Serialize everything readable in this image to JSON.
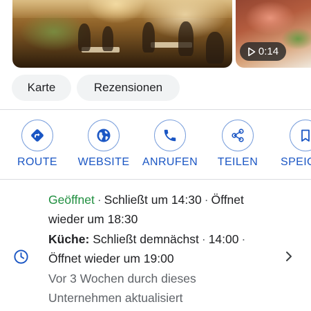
{
  "media": {
    "video_duration": "0:14",
    "play_icon": "play-icon"
  },
  "chips": {
    "map": "Karte",
    "reviews": "Rezensionen"
  },
  "actions": [
    {
      "label": "ROUTE",
      "icon": "directions-icon"
    },
    {
      "label": "WEBSITE",
      "icon": "globe-icon"
    },
    {
      "label": "ANRUFEN",
      "icon": "phone-icon"
    },
    {
      "label": "TEILEN",
      "icon": "share-icon"
    },
    {
      "label": "SPEIC",
      "icon": "bookmark-icon"
    }
  ],
  "hours": {
    "status": "Geöffnet",
    "separator": "·",
    "closes": "Schließt um 14:30",
    "reopens_part1": "Öffnet",
    "reopens_part2": "wieder um 18:30",
    "kitchen_label": "Küche:",
    "kitchen_closes": "Schließt demnächst",
    "kitchen_time": "14:00",
    "kitchen_reopens": "Öffnet wieder um 19:00",
    "updated_line1": "Vor 3 Wochen durch dieses",
    "updated_line2": "Unternehmen aktualisiert"
  },
  "colors": {
    "accent": "#1a56c4",
    "open": "#1e8e3e",
    "chip_bg": "#f1f3f4",
    "muted": "#5f6368"
  }
}
